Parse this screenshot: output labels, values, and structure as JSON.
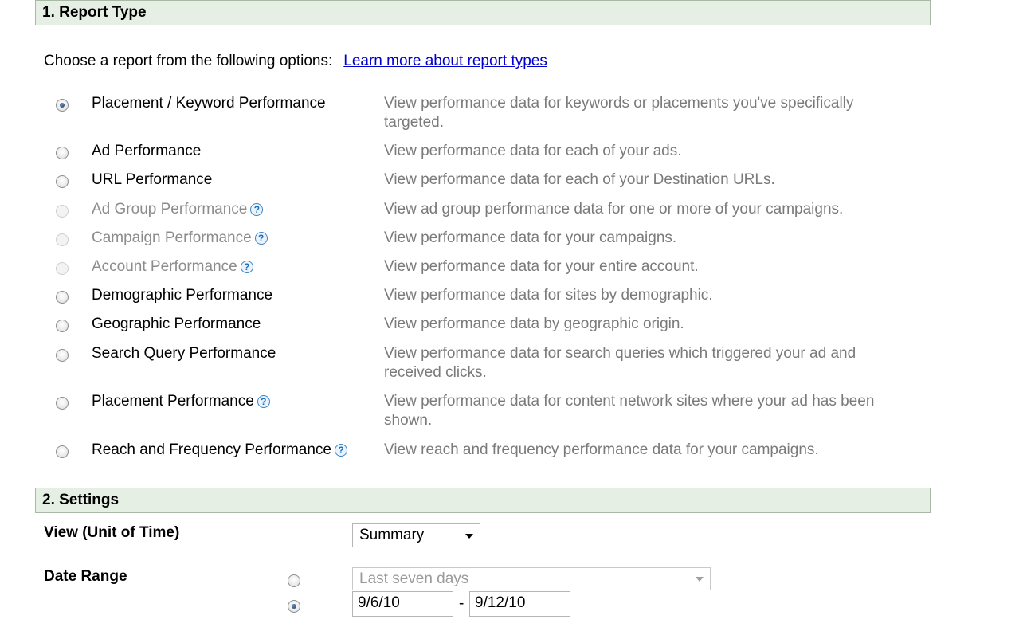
{
  "sections": {
    "report_type": "1. Report Type",
    "settings": "2. Settings"
  },
  "intro": {
    "text": "Choose a report from the following options:",
    "link": "Learn more about report types"
  },
  "options": [
    {
      "label": "Placement / Keyword Performance",
      "desc": "View performance data for keywords or placements you've specifically targeted.",
      "checked": true,
      "disabled": false,
      "help": false
    },
    {
      "label": "Ad Performance",
      "desc": "View performance data for each of your ads.",
      "checked": false,
      "disabled": false,
      "help": false
    },
    {
      "label": "URL Performance",
      "desc": "View performance data for each of your Destination URLs.",
      "checked": false,
      "disabled": false,
      "help": false
    },
    {
      "label": "Ad Group Performance",
      "desc": "View ad group performance data for one or more of your campaigns.",
      "checked": false,
      "disabled": true,
      "help": true
    },
    {
      "label": "Campaign Performance",
      "desc": "View performance data for your campaigns.",
      "checked": false,
      "disabled": true,
      "help": true
    },
    {
      "label": "Account Performance",
      "desc": "View performance data for your entire account.",
      "checked": false,
      "disabled": true,
      "help": true
    },
    {
      "label": "Demographic Performance",
      "desc": "View performance data for sites by demographic.",
      "checked": false,
      "disabled": false,
      "help": false
    },
    {
      "label": "Geographic Performance",
      "desc": "View performance data by geographic origin.",
      "checked": false,
      "disabled": false,
      "help": false
    },
    {
      "label": "Search Query Performance",
      "desc": "View performance data for search queries which triggered your ad and received clicks.",
      "checked": false,
      "disabled": false,
      "help": false
    },
    {
      "label": "Placement Performance",
      "desc": "View performance data for content network sites where your ad has been shown.",
      "checked": false,
      "disabled": false,
      "help": true
    },
    {
      "label": "Reach and Frequency Performance",
      "desc": "View reach and frequency performance data for your campaigns.",
      "checked": false,
      "disabled": false,
      "help": true
    }
  ],
  "help_glyph": "?",
  "settings": {
    "view_label": "View (Unit of Time)",
    "view_value": "Summary",
    "date_label": "Date Range",
    "preset_value": "Last seven days",
    "preset_checked": false,
    "custom_checked": true,
    "start_date": "9/6/10",
    "end_date": "9/12/10",
    "dash": "-"
  }
}
